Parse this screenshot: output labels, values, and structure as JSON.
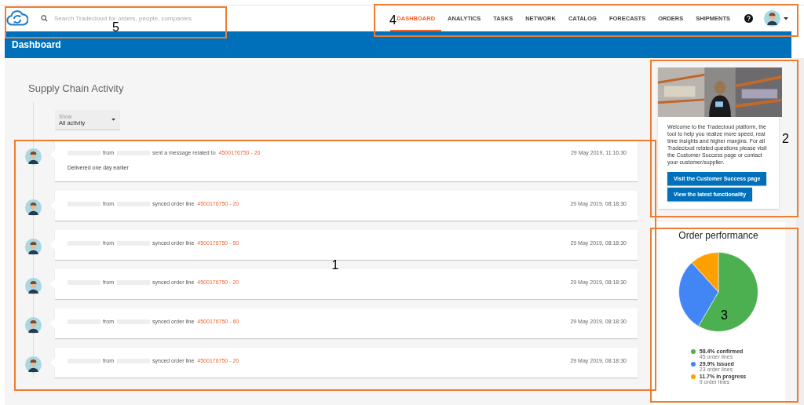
{
  "header": {
    "search": {
      "placeholder": "Search Tradecloud for orders, people, companies",
      "annotation": "5"
    },
    "nav": {
      "annotation": "4",
      "items": [
        {
          "label": "DASHBOARD",
          "selected": true
        },
        {
          "label": "ANALYTICS",
          "selected": false
        },
        {
          "label": "TASKS",
          "selected": false
        },
        {
          "label": "NETWORK",
          "selected": false
        },
        {
          "label": "CATALOG",
          "selected": false
        },
        {
          "label": "FORECASTS",
          "selected": false
        },
        {
          "label": "ORDERS",
          "selected": false
        },
        {
          "label": "SHIPMENTS",
          "selected": false
        }
      ]
    }
  },
  "page_title": "Dashboard",
  "activity": {
    "title": "Supply Chain Activity",
    "annotation": "1",
    "filter": {
      "label": "Show",
      "value": "All activity"
    },
    "items": [
      {
        "from": "from",
        "action": "sent a message related to",
        "link": "4500176750 - 20",
        "time": "29 May 2019, 11:16:30",
        "message": "Delivered one day earlier"
      },
      {
        "from": "from",
        "action": "synced order line",
        "link": "4500176750 - 20",
        "time": "29 May 2019, 08:18:30"
      },
      {
        "from": "from",
        "action": "synced order line",
        "link": "4500176750 - 50",
        "time": "29 May 2019, 08:18:30"
      },
      {
        "from": "from",
        "action": "synced order line",
        "link": "4500176750 - 20",
        "time": "29 May 2019, 08:18:30"
      },
      {
        "from": "from",
        "action": "synced order line",
        "link": "4500176750 - 60",
        "time": "29 May 2019, 08:18:30"
      },
      {
        "from": "from",
        "action": "synced order line",
        "link": "4500176750 - 20",
        "time": "29 May 2019, 08:18:30"
      }
    ]
  },
  "welcome": {
    "annotation": "2",
    "text": "Welcome to the Tradecloud platform, the tool to help you realize more speed, real time insights and higher margins. For all Tradecloud related questions please visit the Customer Success page or contact your customer/supplier.",
    "buttons": [
      "Visit the Customer Success page",
      "View the latest functionality"
    ]
  },
  "order_performance": {
    "title": "Order performance",
    "annotation": "3",
    "chart_data": {
      "type": "pie",
      "categories": [
        "58.4% confirmed",
        "29.9% issued",
        "11.7% in progress"
      ],
      "values": [
        58.4,
        29.9,
        11.7
      ]
    },
    "legend": [
      {
        "detail": "45 order lines",
        "color": "#4caf50"
      },
      {
        "detail": "23 order lines",
        "color": "#4285f4"
      },
      {
        "detail": "9 order lines",
        "color": "#ff9f00"
      }
    ]
  }
}
